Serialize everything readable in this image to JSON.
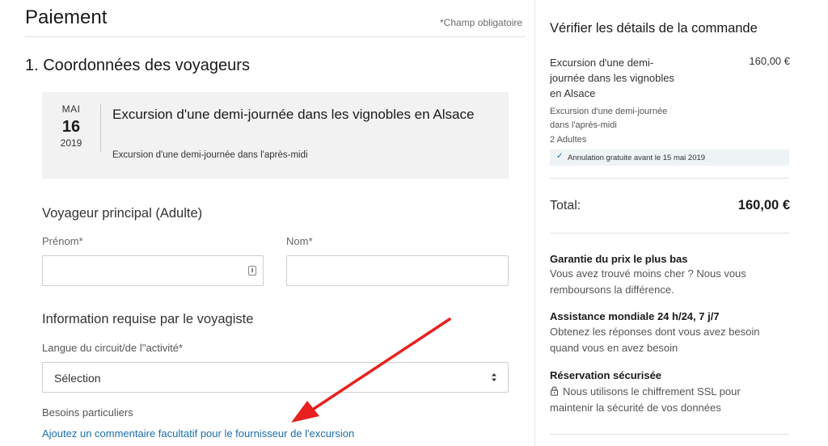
{
  "header": {
    "title": "Paiement",
    "required_note": "*Champ obligatoire"
  },
  "section": {
    "title": "1. Coordonnées des voyageurs"
  },
  "tour": {
    "month": "MAI",
    "day": "16",
    "year": "2019",
    "title": "Excursion d'une demi-journée dans les vignobles en Alsace",
    "subtitle": "Excursion d'une demi-journée dans l'après-midi"
  },
  "traveler": {
    "heading": "Voyageur principal (Adulte)",
    "first_name_label": "Prénom*",
    "first_name_value": "",
    "last_name_label": "Nom*",
    "last_name_value": ""
  },
  "operator_info": {
    "heading": "Information requise par le voyagiste",
    "language_label": "Langue du circuit/de l''activité*",
    "language_selected": "Sélection",
    "special_needs_label": "Besoins particuliers",
    "comment_link": "Ajoutez un commentaire facultatif pour le fournisseur de l'excursion"
  },
  "summary": {
    "title": "Vérifier les détails de la commande",
    "item_name": "Excursion d'une demi-journée dans les vignobles en Alsace",
    "item_price": "160,00 €",
    "item_option": "Excursion d'une demi-journée dans l'après-midi",
    "quantity": "2 Adultes",
    "cancellation": "Annulation gratuite avant le 15 mai 2019",
    "total_label": "Total:",
    "total_value": "160,00 €"
  },
  "features": [
    {
      "title": "Garantie du prix le plus bas",
      "body": "Vous avez trouvé moins cher ? Nous vous remboursons la différence."
    },
    {
      "title": "Assistance mondiale 24 h/24, 7 j/7",
      "body": "Obtenez les réponses dont vous avez besoin quand vous en avez besoin"
    },
    {
      "title": "Réservation sécurisée",
      "body": "Nous utilisons le chiffrement SSL pour maintenir la sécurité de vos données"
    }
  ],
  "colors": {
    "link": "#1a6ea8",
    "annotation_arrow": "#e8201f",
    "card_background": "#f2f2f2"
  }
}
